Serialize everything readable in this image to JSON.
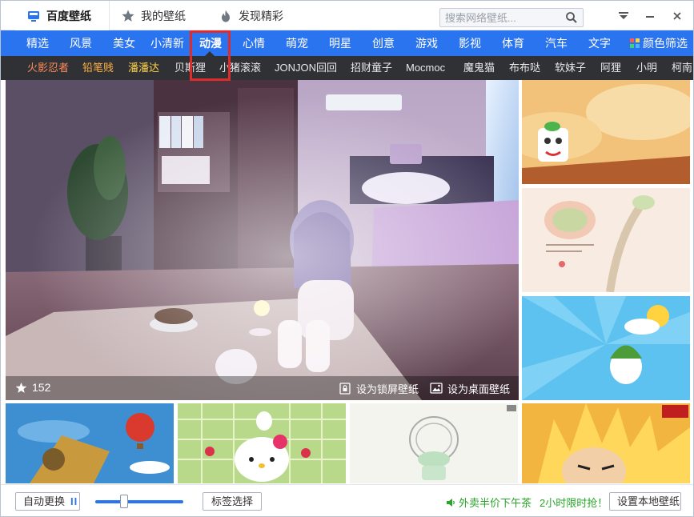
{
  "titlebar": {
    "tabs": [
      {
        "label": "百度壁纸",
        "icon": "wallpaper-logo-icon"
      },
      {
        "label": "我的壁纸",
        "icon": "star-icon"
      },
      {
        "label": "发现精彩",
        "icon": "flame-icon"
      }
    ],
    "search_placeholder": "搜索网络壁纸..."
  },
  "categories": {
    "items": [
      "精选",
      "风景",
      "美女",
      "小清新",
      "动漫",
      "心情",
      "萌宠",
      "明星",
      "创意",
      "游戏",
      "影视",
      "体育",
      "汽车",
      "文字",
      "颜色筛选"
    ],
    "active": "动漫"
  },
  "tags": {
    "items": [
      "火影忍者",
      "铅笔贱",
      "潘潘达",
      "贝斯狸",
      "小猪滚滚",
      "JONJON回回",
      "招财童子",
      "Mocmoc",
      "魔鬼猫",
      "布布哒",
      "软妹子",
      "阿狸",
      "小明",
      "柯南"
    ]
  },
  "hero": {
    "likes": "152",
    "set_lock": "设为锁屏壁纸",
    "set_desktop": "设为桌面壁纸"
  },
  "bottom": {
    "auto_change": "自动更换",
    "pause_symbol": "II",
    "slider_level": 0.33,
    "tag_select": "标签选择",
    "promo_text_1": "外卖半价下午茶",
    "promo_text_2": "2小时限时抢！",
    "set_local": "设置本地壁纸"
  },
  "colors": {
    "accent": "#2b74ef",
    "tagbar": "#2f3135",
    "highlight": "#e02b2b",
    "promo": "#2aa52a"
  }
}
